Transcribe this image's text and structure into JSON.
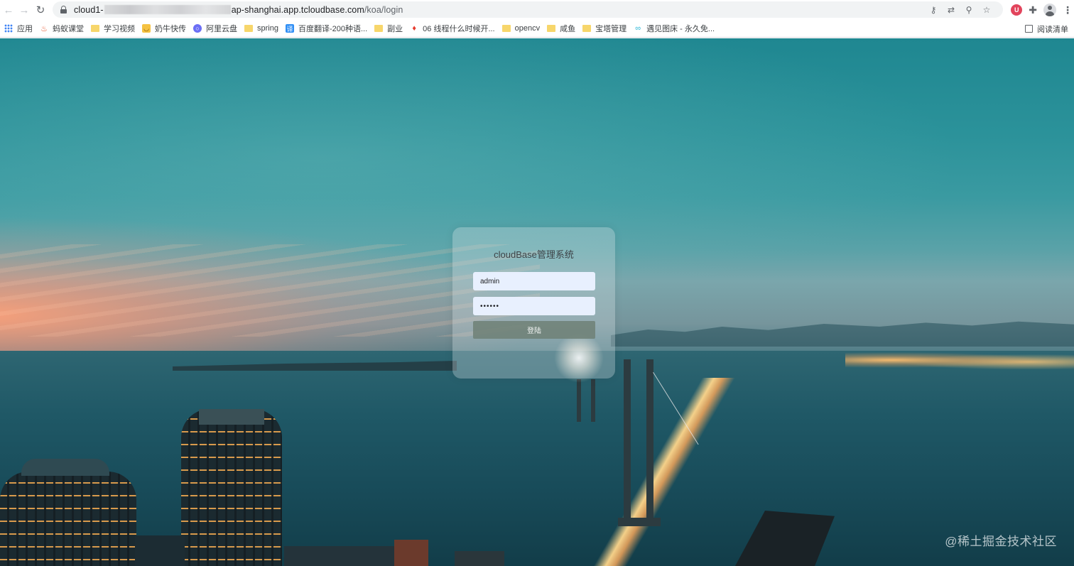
{
  "browser": {
    "url": {
      "prefix": "cloud1-",
      "domain": "ap-shanghai.app.tcloudbase.com",
      "path": "/koa/login"
    },
    "bookmarks": [
      {
        "label": "应用",
        "icon": "apps-grid-icon"
      },
      {
        "label": "蚂蚁课堂",
        "icon": "ant-icon"
      },
      {
        "label": "学习视频",
        "icon": "folder-icon"
      },
      {
        "label": "奶牛快传",
        "icon": "cow-icon"
      },
      {
        "label": "阿里云盘",
        "icon": "aliyun-drive-icon"
      },
      {
        "label": "spring",
        "icon": "folder-icon"
      },
      {
        "label": "百度翻译-200种语...",
        "icon": "baidu-translate-icon"
      },
      {
        "label": "副业",
        "icon": "folder-icon"
      },
      {
        "label": "06 线程什么时候开...",
        "icon": "fire-icon"
      },
      {
        "label": "opencv",
        "icon": "folder-icon"
      },
      {
        "label": "咸鱼",
        "icon": "folder-icon"
      },
      {
        "label": "宝塔管理",
        "icon": "folder-icon"
      },
      {
        "label": "遇见图床 - 永久免...",
        "icon": "link-icon"
      }
    ],
    "reading_list": "阅读清单",
    "extension_badge": "U"
  },
  "login": {
    "title": "cloudBase管理系统",
    "username_value": "admin",
    "password_value": "••••••",
    "submit_label": "登陆"
  },
  "watermark": "@稀土掘金技术社区"
}
